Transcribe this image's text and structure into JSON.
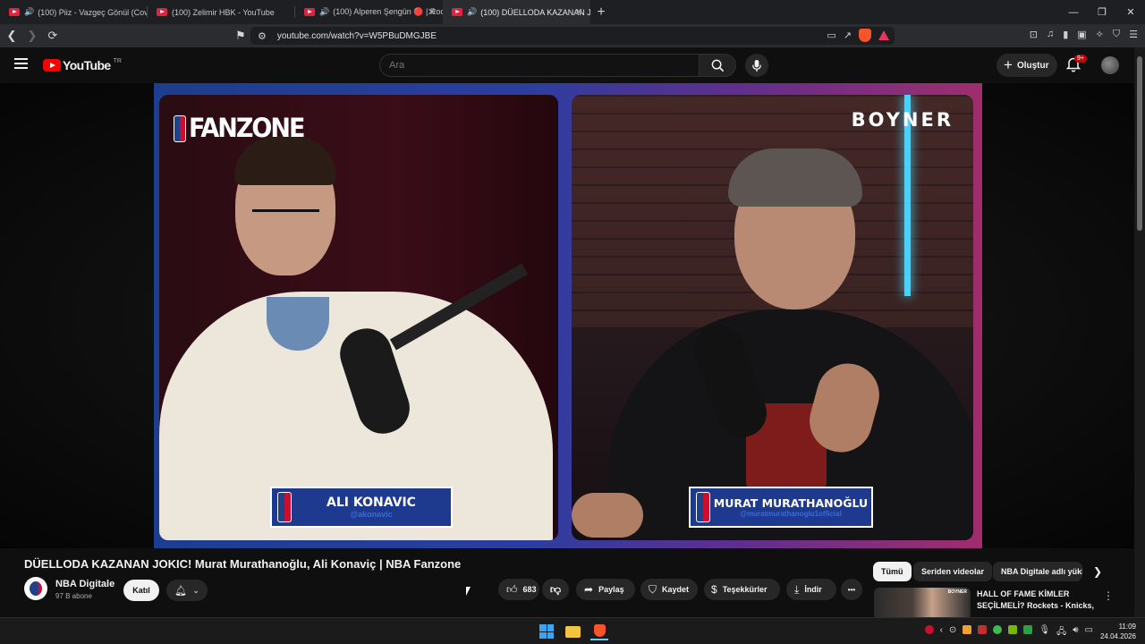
{
  "browser": {
    "tabs": [
      {
        "label": "(100) Piiz - Vazgeç Gönül (Cover)",
        "audio": true
      },
      {
        "label": "(100) Zelimir HBK - YouTube",
        "audio": false
      },
      {
        "label": "(100) Alperen Şengün 🔴 | Rockets",
        "audio": true
      },
      {
        "label": "(100) DÜELLODA KAZANAN J",
        "audio": true
      }
    ],
    "url": "youtube.com/watch?v=W5PBuDMGJBE",
    "window_controls": {
      "minimize": "—",
      "restore": "❐",
      "close": "✕"
    }
  },
  "youtube": {
    "logo_text": "YouTube",
    "country_code": "TR",
    "search_placeholder": "Ara",
    "create_label": "Oluştur",
    "notification_count": "9+"
  },
  "video": {
    "overlay_brand": "FANZONE",
    "sponsor": "BOYNER",
    "guests": [
      {
        "name": "ALI KONAVIC",
        "handle": "@akonavic"
      },
      {
        "name": "MURAT MURATHANOĞLU",
        "handle": "@muratmurathanoglu1official"
      }
    ],
    "title": "DÜELLODA KAZANAN JOKIC! Murat Murathanoğlu, Ali Konaviç | NBA Fanzone"
  },
  "channel": {
    "name": "NBA Digitale",
    "subscribers": "97 B abone",
    "join_label": "Katıl"
  },
  "actions": {
    "like_count": "683",
    "share_label": "Paylaş",
    "save_label": "Kaydet",
    "thanks_label": "Teşekkürler",
    "download_label": "İndir",
    "more": "•••"
  },
  "sidebar": {
    "chips": [
      "Tümü",
      "Seriden videolar",
      "NBA Digitale adlı yükl"
    ],
    "recommendation": {
      "thumb_brand": "BOYNER",
      "title": "HALL OF FAME KİMLER SEÇİLMELİ? Rockets - Knicks, ..."
    }
  },
  "taskbar": {
    "time": "11:09",
    "date": "24.04.2026"
  },
  "colors": {
    "yt_red": "#ff0000",
    "nba_blue": "#1d428a",
    "nba_red": "#c8102e",
    "page_bg": "#0f0f0f"
  }
}
